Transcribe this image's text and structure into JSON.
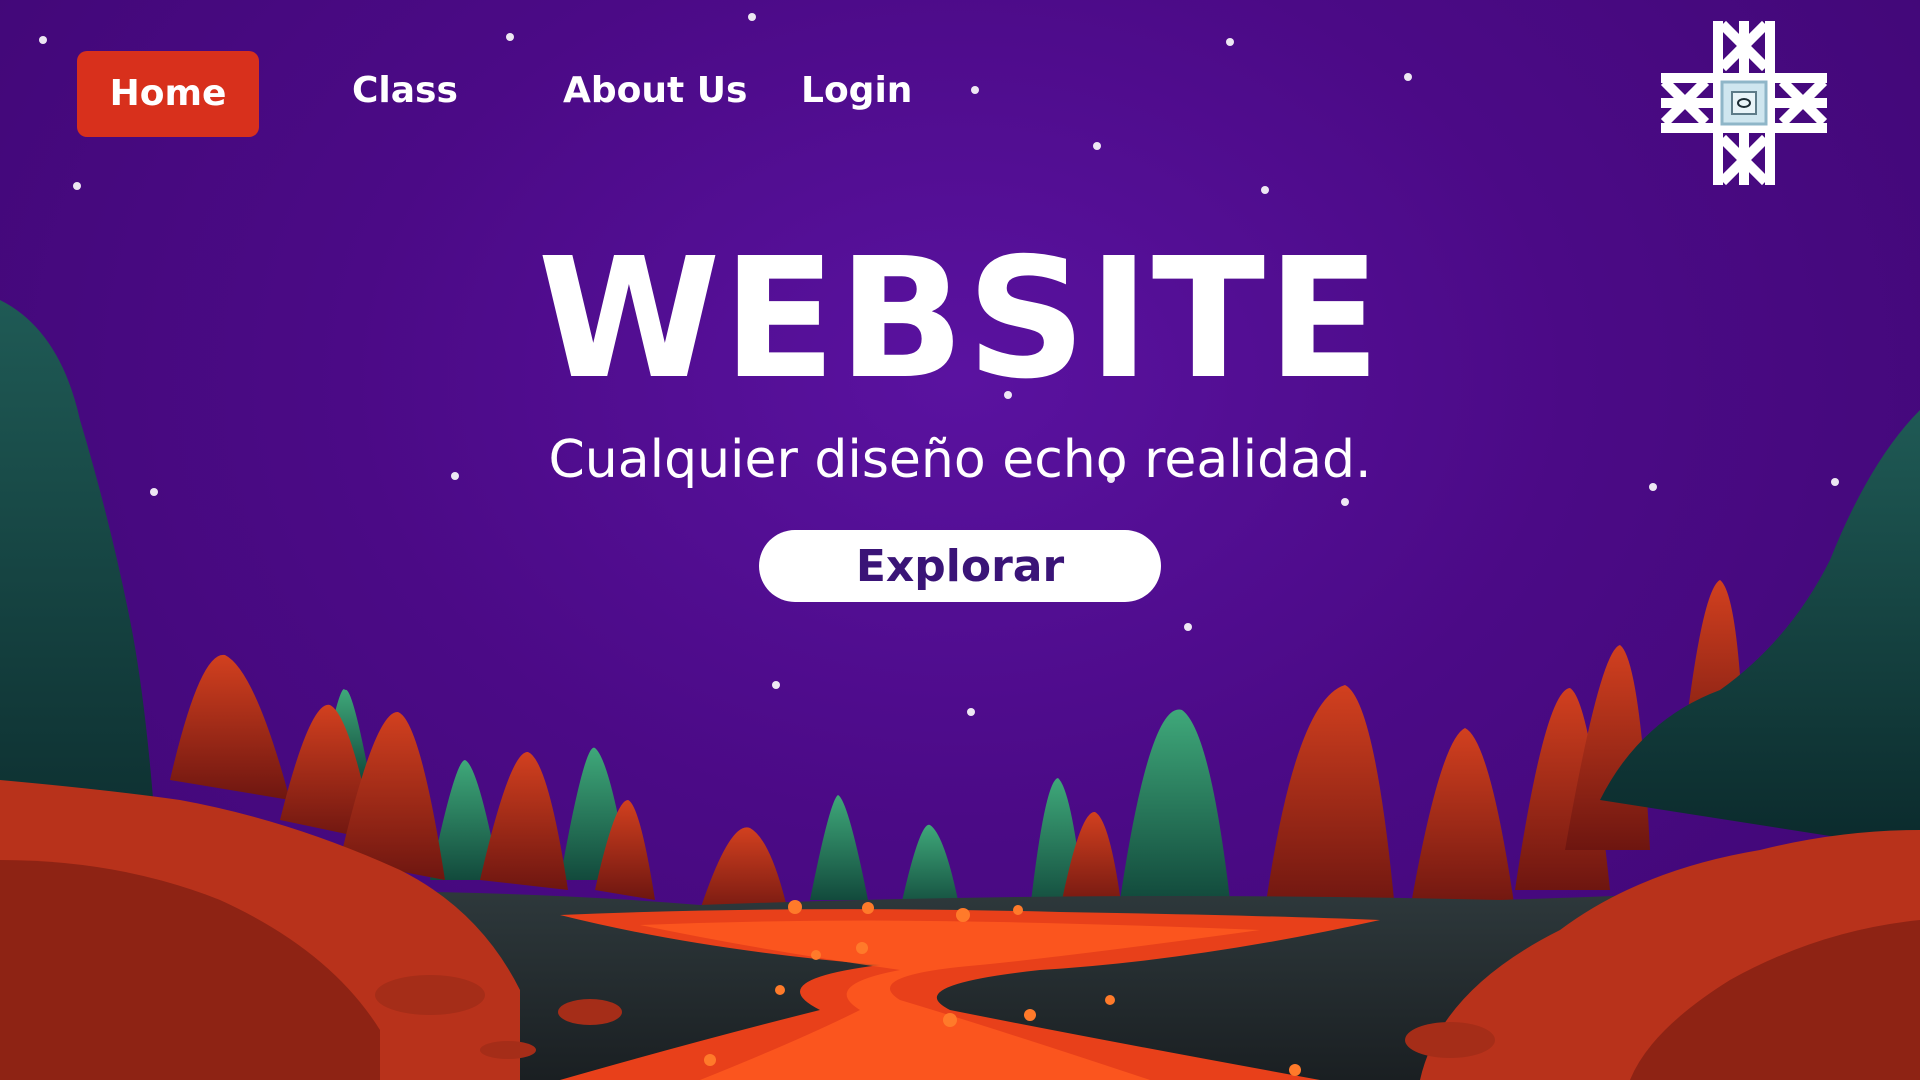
{
  "nav": {
    "home_label": "Home",
    "class_label": "Class",
    "about_label": "About Us",
    "login_label": "Login",
    "active": "Home"
  },
  "hero": {
    "title": "WEBSITE",
    "subtitle": "Cualquier diseño echo realidad.",
    "cta_label": "Explorar"
  },
  "logo": {
    "icon": "snowflake-chip-logo"
  },
  "colors": {
    "background": "#4d0a86",
    "accent": "#d8301c",
    "cta_text": "#3a1477",
    "lava": "#e8401a",
    "rock_red": "#b8321b",
    "rock_green": "#2f8a64"
  }
}
